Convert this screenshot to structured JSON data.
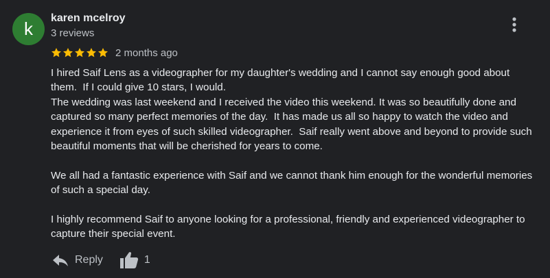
{
  "reviewer": {
    "initial": "k",
    "name": "karen mcelroy",
    "review_count": "3 reviews",
    "avatar_color": "#2e7d32"
  },
  "rating": {
    "stars": 5,
    "max_stars": 5,
    "star_color": "#fbbc04",
    "date": "2 months ago"
  },
  "menu": {
    "icon": "more-vert-icon"
  },
  "review": {
    "paragraphs": [
      [
        "I hired Saif Lens as a videographer for my daughter's wedding and I cannot say enough good about",
        "them.  If I could give 10 stars, I would.",
        "The wedding was last weekend and I received the video this weekend. It was so beautifully done and",
        "captured so many perfect memories of the day.  It has made us all so happy to watch the video and",
        "experience it from eyes of such skilled videographer.  Saif really went above and beyond to provide such",
        "beautiful moments that will be cherished for years to come."
      ],
      [
        "We all had a fantastic experience with Saif and we cannot thank him enough for the wonderful memories",
        "of such a special day."
      ],
      [
        "I highly recommend Saif to anyone looking for a professional, friendly and experienced videographer to",
        "capture their special event."
      ]
    ]
  },
  "actions": {
    "reply_label": "Reply",
    "reply_icon": "reply-icon",
    "like_icon": "thumbs-up-icon",
    "like_count": "1"
  }
}
